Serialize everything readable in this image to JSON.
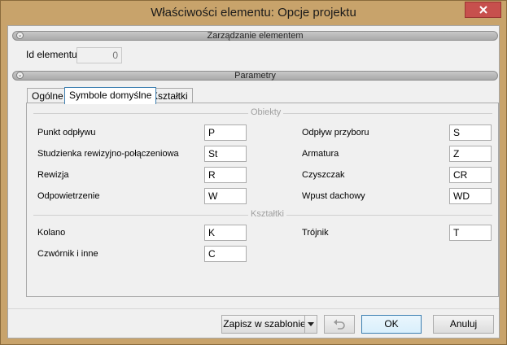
{
  "window": {
    "title": "Właściwości elementu: Opcje projektu",
    "close_icon": "close-icon"
  },
  "sections": {
    "management": "Zarządzanie elementem",
    "parameters": "Parametry"
  },
  "element_id": {
    "label": "Id elementu",
    "value": "0"
  },
  "tabs": [
    {
      "label": "Ogólne",
      "active": false
    },
    {
      "label": "Symbole domyślne",
      "active": true
    },
    {
      "label": "Kształtki",
      "active": false
    }
  ],
  "groups": {
    "objects": {
      "title": "Obiekty",
      "left": [
        {
          "label": "Punkt odpływu",
          "value": "P"
        },
        {
          "label": "Studzienka rewizyjno-połączeniowa",
          "value": "St"
        },
        {
          "label": "Rewizja",
          "value": "R"
        },
        {
          "label": "Odpowietrzenie",
          "value": "W"
        }
      ],
      "right": [
        {
          "label": "Odpływ przyboru",
          "value": "S"
        },
        {
          "label": "Armatura",
          "value": "Z"
        },
        {
          "label": "Czyszczak",
          "value": "CR"
        },
        {
          "label": "Wpust dachowy",
          "value": "WD"
        }
      ]
    },
    "fittings": {
      "title": "Kształtki",
      "left": [
        {
          "label": "Kolano",
          "value": "K"
        },
        {
          "label": "Czwórnik i inne",
          "value": "C"
        }
      ],
      "right": [
        {
          "label": "Trójnik",
          "value": "T"
        }
      ]
    }
  },
  "buttons": {
    "save_template": "Zapisz w szablonie",
    "dropdown_icon": "chevron-down-icon",
    "undo_icon": "undo-icon",
    "ok": "OK",
    "cancel": "Anuluj"
  }
}
